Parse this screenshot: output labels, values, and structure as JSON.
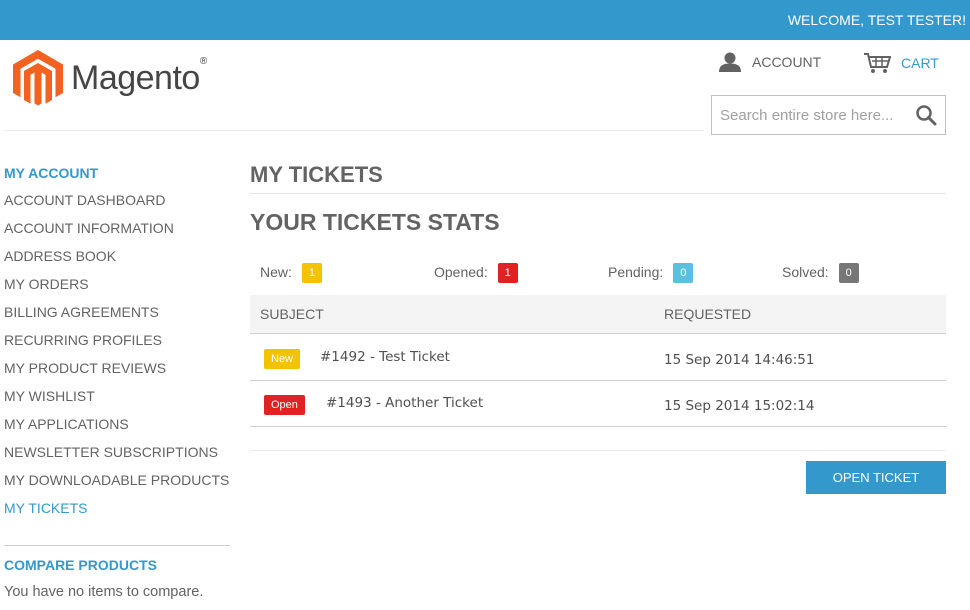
{
  "header": {
    "welcome": "WELCOME, TEST TESTER!",
    "logo_text": "Magento",
    "logo_reg": "®",
    "account_label": "ACCOUNT",
    "cart_label": "CART",
    "search_placeholder": "Search entire store here..."
  },
  "sidebar": {
    "title": "MY ACCOUNT",
    "items": [
      {
        "label": "ACCOUNT DASHBOARD",
        "active": false
      },
      {
        "label": "ACCOUNT INFORMATION",
        "active": false
      },
      {
        "label": "ADDRESS BOOK",
        "active": false
      },
      {
        "label": "MY ORDERS",
        "active": false
      },
      {
        "label": "BILLING AGREEMENTS",
        "active": false
      },
      {
        "label": "RECURRING PROFILES",
        "active": false
      },
      {
        "label": "MY PRODUCT REVIEWS",
        "active": false
      },
      {
        "label": "MY WISHLIST",
        "active": false
      },
      {
        "label": "MY APPLICATIONS",
        "active": false
      },
      {
        "label": "NEWSLETTER SUBSCRIPTIONS",
        "active": false
      },
      {
        "label": "MY DOWNLOADABLE PRODUCTS",
        "active": false
      },
      {
        "label": "MY TICKETS",
        "active": true
      }
    ],
    "compare_title": "COMPARE PRODUCTS",
    "compare_text": "You have no items to compare."
  },
  "main": {
    "page_title": "MY TICKETS",
    "stats_title": "YOUR TICKETS STATS",
    "stats": [
      {
        "label": "New:",
        "count": "1",
        "color": "#f3c200"
      },
      {
        "label": "Opened:",
        "count": "1",
        "color": "#e02222"
      },
      {
        "label": "Pending:",
        "count": "0",
        "color": "#5bc0de"
      },
      {
        "label": "Solved:",
        "count": "0",
        "color": "#777777"
      }
    ],
    "table": {
      "headers": [
        "SUBJECT",
        "REQUESTED"
      ],
      "rows": [
        {
          "status": "New",
          "status_color": "#f3c200",
          "subject": "#1492 - Test Ticket",
          "requested": "15 Sep 2014 14:46:51"
        },
        {
          "status": "Open",
          "status_color": "#e02222",
          "subject": "#1493 - Another Ticket",
          "requested": "15 Sep 2014 15:02:14"
        }
      ]
    },
    "open_ticket_label": "OPEN TICKET"
  },
  "colors": {
    "accent": "#3399cc",
    "logo_orange": "#f26322"
  },
  "icons": {
    "account": "person-icon",
    "cart": "cart-icon",
    "search": "search-icon"
  }
}
